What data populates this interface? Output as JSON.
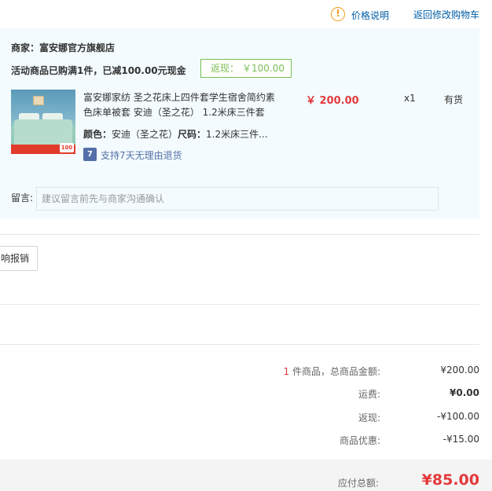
{
  "header": {
    "info_icon_glyph": "!",
    "price_explain": "价格说明",
    "back_to_cart": "返回修改购物车"
  },
  "order": {
    "shop_name": "商家：富安娜官方旗舰店",
    "promotion": "活动商品已购满1件，已减100.00元现金",
    "cashback_label": "返现：",
    "cashback_value": "￥100.00",
    "product": {
      "title": "富安娜家纺 圣之花床上四件套学生宿舍简约素色床单被套 安迪（圣之花） 1.2米床三件套",
      "price": "￥ 200.00",
      "quantity": "x1",
      "stock": "有货",
      "color_label": "颜色：",
      "color_value": "安迪（圣之花）",
      "size_label": "尺码：",
      "size_value": "1.2米床三件...",
      "return_icon_glyph": "7",
      "return_policy": "支持7天无理由退货",
      "image_badge_text": "100"
    },
    "remark_label": "留言:",
    "remark_placeholder": "建议留言前先与商家沟通确认"
  },
  "invoice": {
    "button_label": "响报销"
  },
  "summary": {
    "item_count": "1",
    "item_total_label": " 件商品，总商品金额:",
    "item_total_value": "¥200.00",
    "shipping_label": "运费:",
    "shipping_value": "¥0.00",
    "cashback_label": "返现:",
    "cashback_value": "-¥100.00",
    "discount_label": "商品优惠:",
    "discount_value": "-¥15.00",
    "payable_label": "应付总额:",
    "payable_value": "¥85.00"
  },
  "colors": {
    "accent_red": "#e4393c",
    "link_blue": "#005ea7",
    "cashback_green": "#7abd54",
    "panel_bg": "#f3fbfe",
    "warning_orange": "#f0a020"
  }
}
